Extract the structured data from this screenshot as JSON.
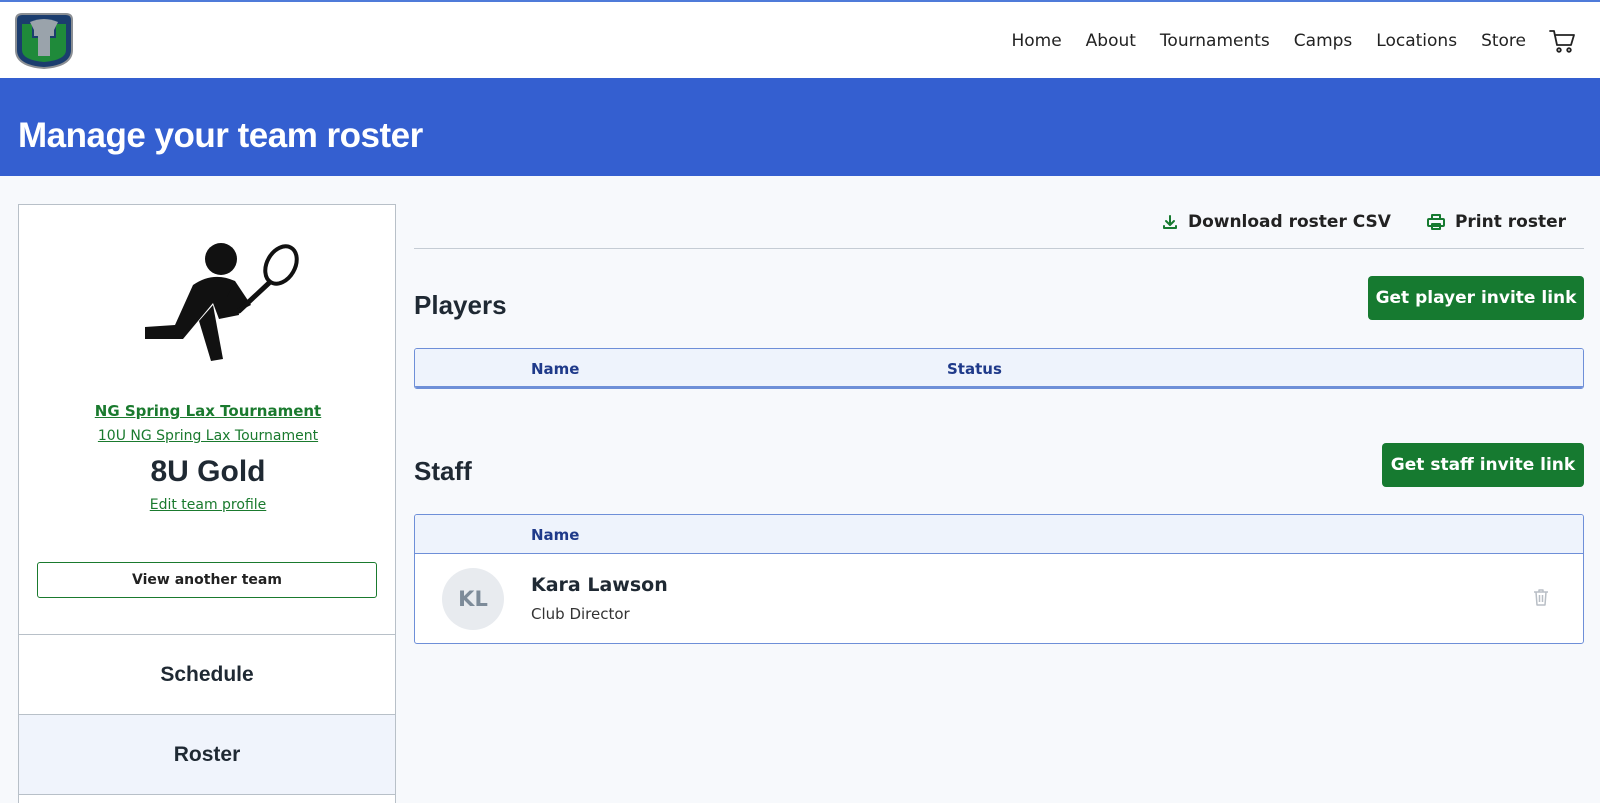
{
  "nav": {
    "links": [
      "Home",
      "About",
      "Tournaments",
      "Camps",
      "Locations",
      "Store"
    ],
    "cart_icon": "cart-icon",
    "logo_icon": "whale-logo"
  },
  "banner": {
    "title": "Manage your team roster"
  },
  "sidebar": {
    "tournament": "NG Spring Lax Tournament",
    "division": "10U NG Spring Lax Tournament",
    "team_name": "8U Gold",
    "edit_profile": "Edit team profile",
    "view_another": "View another team",
    "tabs": [
      "Schedule",
      "Roster"
    ]
  },
  "actions": {
    "download": "Download roster CSV",
    "print": "Print roster"
  },
  "players": {
    "title": "Players",
    "invite": "Get player invite link",
    "columns": [
      "Name",
      "Status"
    ]
  },
  "staff": {
    "title": "Staff",
    "invite": "Get staff invite link",
    "columns": [
      "Name"
    ],
    "rows": [
      {
        "initials": "KL",
        "name": "Kara Lawson",
        "role": "Club Director"
      }
    ]
  },
  "colors": {
    "banner": "#345fd0",
    "primary_green": "#167a30",
    "link_green": "#1a7a2e",
    "table_border": "#6e8fd8"
  }
}
